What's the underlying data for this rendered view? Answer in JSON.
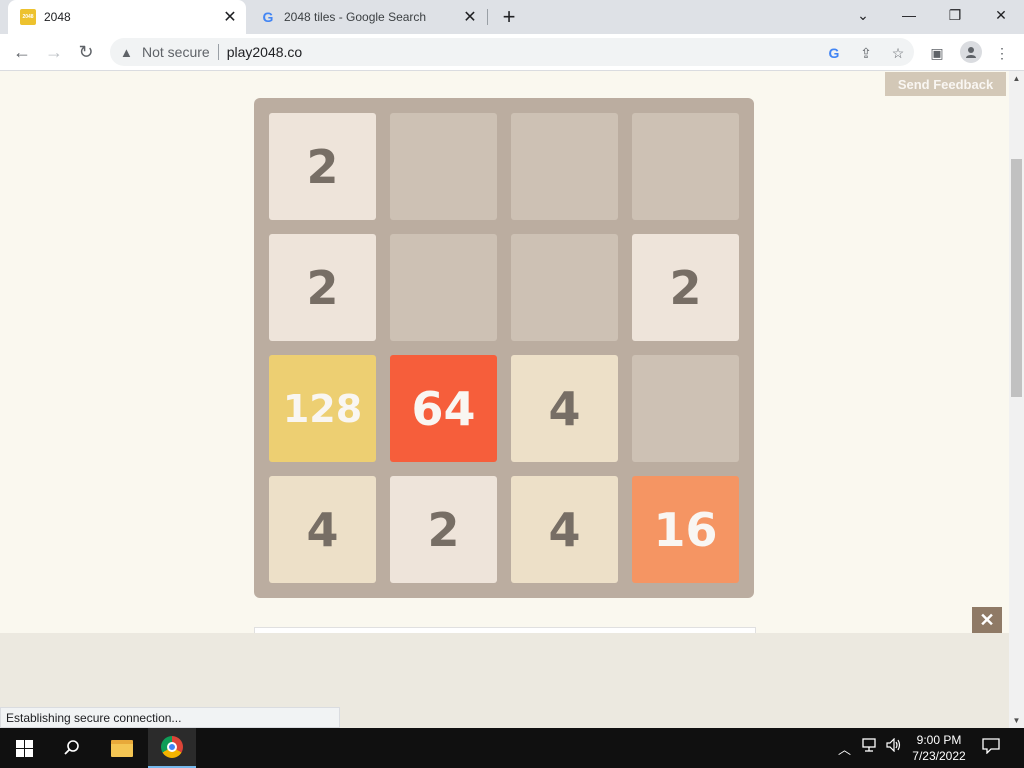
{
  "browser": {
    "tabs": [
      {
        "title": "2048",
        "favicon_text": "2048",
        "active": true
      },
      {
        "title": "2048 tiles - Google Search",
        "favicon_text": "G",
        "active": false
      }
    ],
    "tab_close_glyph": "✕",
    "new_tab_glyph": "+",
    "window_controls": {
      "tab_search": "⌄",
      "minimize": "—",
      "restore": "❐",
      "close": "✕"
    },
    "nav": {
      "back": "←",
      "forward": "→",
      "reload": "↻"
    },
    "security_label": "Not secure",
    "url": "play2048.co",
    "status_text": "Establishing secure connection..."
  },
  "page": {
    "feedback_label": "Send Feedback",
    "close_ad_glyph": "✕",
    "board": [
      [
        "2",
        "",
        "",
        ""
      ],
      [
        "2",
        "",
        "",
        "2"
      ],
      [
        "128",
        "64",
        "4",
        ""
      ],
      [
        "4",
        "2",
        "4",
        "16"
      ]
    ]
  },
  "taskbar": {
    "time": "9:00 PM",
    "date": "7/23/2022"
  },
  "colors": {
    "board_bg": "#bbada0",
    "empty_cell": "#cdc1b4",
    "tile_2": "#eee4da",
    "tile_4": "#ede0c8",
    "tile_16": "#f59563",
    "tile_64": "#f65e3b",
    "tile_128": "#edcf72"
  }
}
